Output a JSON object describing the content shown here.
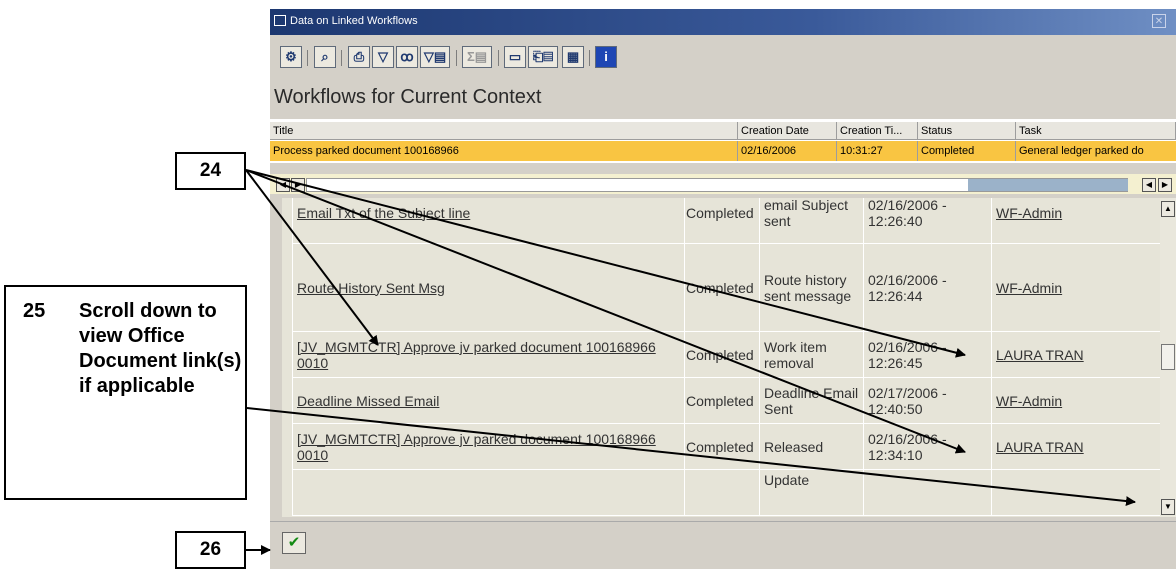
{
  "window": {
    "title": "Data on Linked Workflows",
    "close_glyph": "✕"
  },
  "toolbar": {
    "icons": [
      "workflow-icon",
      "magnifier-icon",
      "print-icon",
      "filter-icon",
      "binoculars-icon",
      "set-filter-icon",
      "sum-icon",
      "print-preview-icon",
      "export-icon",
      "grid-layout-icon",
      "info-icon"
    ]
  },
  "heading": "Workflows for Current Context",
  "grid": {
    "columns": [
      "Title",
      "Creation Date",
      "Creation Ti...",
      "Status",
      "Task"
    ],
    "row": [
      "Process parked document 100168966",
      "02/16/2006",
      "10:31:27",
      "Completed",
      "General ledger parked do"
    ]
  },
  "steps": [
    {
      "title": "Email Txt of the Subject line",
      "status": "Completed",
      "description": "email Subject sent",
      "datetime": "02/16/2006 - 12:26:40",
      "agent": "WF-Admin"
    },
    {
      "title": "Route History Sent Msg",
      "status": "Completed",
      "description": "Route history sent message",
      "datetime": "02/16/2006 - 12:26:44",
      "agent": "WF-Admin"
    },
    {
      "title": "[JV_MGMTCTR] Approve jv parked document 100168966 0010",
      "status": "Completed",
      "description": "Work item removal",
      "datetime": "02/16/2006 - 12:26:45",
      "agent": "LAURA TRAN"
    },
    {
      "title": "Deadline Missed Email",
      "status": "Completed",
      "description": "Deadline Email Sent",
      "datetime": "02/17/2006 - 12:40:50",
      "agent": "WF-Admin"
    },
    {
      "title": "[JV_MGMTCTR] Approve jv parked document 100168966 0010",
      "status": "Completed",
      "description": "Released",
      "datetime": "02/16/2006 - 12:34:10",
      "agent": "LAURA TRAN"
    },
    {
      "title": "",
      "status": "",
      "description": "Update",
      "datetime": "",
      "agent": ""
    }
  ],
  "callouts": {
    "c24": "24",
    "c25_num": "25",
    "c25_text": "Scroll down to view Office Document link(s) if applicable",
    "c26": "26"
  },
  "footer": {
    "ok_glyph": "✔"
  },
  "colors": {
    "selected_row": "#f9c542",
    "title_bar": "#1c3770",
    "ok_check": "#138a13"
  }
}
